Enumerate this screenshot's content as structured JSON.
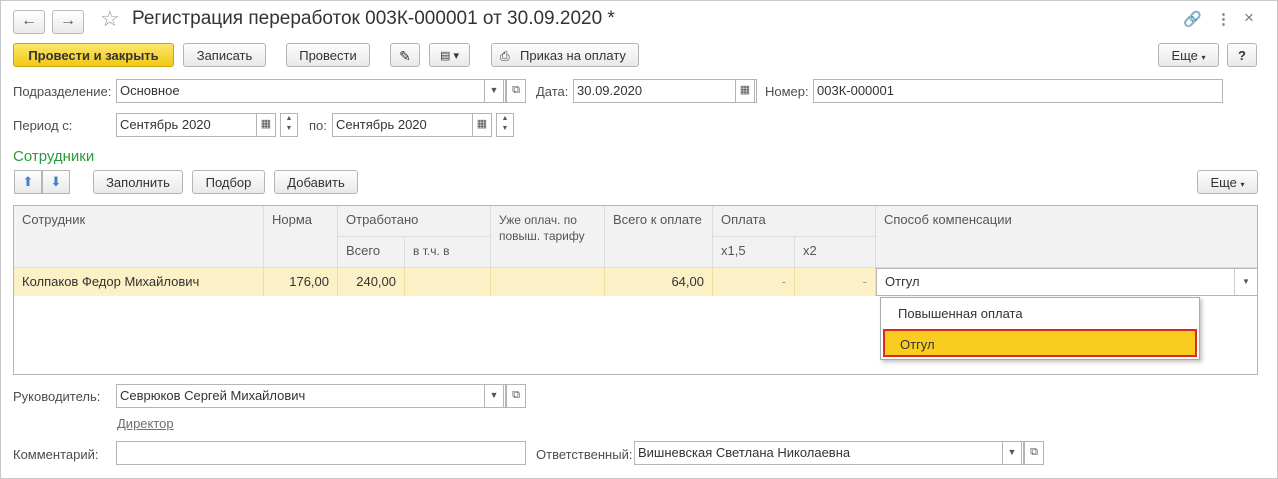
{
  "header": {
    "back_icon": "←",
    "forward_icon": "→",
    "title": "Регистрация переработок 003К-000001 от 30.09.2020 *",
    "link_icon": "🔗",
    "menu_icon": "⋮",
    "close_icon": "×"
  },
  "toolbar": {
    "post_close": "Провести и закрыть",
    "save": "Записать",
    "post": "Провести",
    "print_order": "Приказ на оплату",
    "more": "Еще",
    "help": "?"
  },
  "form": {
    "division_label": "Подразделение:",
    "division_value": "Основное",
    "date_label": "Дата:",
    "date_value": "30.09.2020",
    "number_label": "Номер:",
    "number_value": "003К-000001",
    "period_from_label": "Период с:",
    "period_from_value": "Сентябрь 2020",
    "period_to_label": "по:",
    "period_to_value": "Сентябрь 2020"
  },
  "employees": {
    "section_title": "Сотрудники",
    "fill": "Заполнить",
    "pick": "Подбор",
    "add": "Добавить",
    "more": "Еще",
    "columns": {
      "employee": "Сотрудник",
      "norm": "Норма",
      "worked": "Отработано",
      "worked_total": "Всего",
      "worked_incl": "в т.ч. в",
      "already_paid": "Уже оплач. по повыш. тарифу",
      "total_to_pay": "Всего к оплате",
      "payment": "Оплата",
      "x15": "х1,5",
      "x2": "х2",
      "compensation": "Способ компенсации"
    },
    "rows": [
      {
        "employee": "Колпаков Федор Михайлович",
        "norm": "176,00",
        "worked_total": "240,00",
        "worked_incl": "",
        "already_paid": "",
        "total_to_pay": "64,00",
        "x15": "-",
        "x2": "-",
        "compensation": "Отгул"
      }
    ],
    "compensation_options": [
      "Повышенная оплата",
      "Отгул"
    ],
    "selected_option": "Отгул"
  },
  "footer": {
    "manager_label": "Руководитель:",
    "manager_value": "Севрюков Сергей Михайлович",
    "manager_position": "Директор",
    "comment_label": "Комментарий:",
    "comment_value": "",
    "responsible_label": "Ответственный:",
    "responsible_value": "Вишневская Светлана Николаевна"
  },
  "colors": {
    "primary_button": "#f3c814",
    "section_title": "#2a9a3b",
    "selected_row": "#fbf0c6",
    "dropdown_selected": "#f9cc22",
    "dropdown_highlight_border": "#e0281e"
  }
}
